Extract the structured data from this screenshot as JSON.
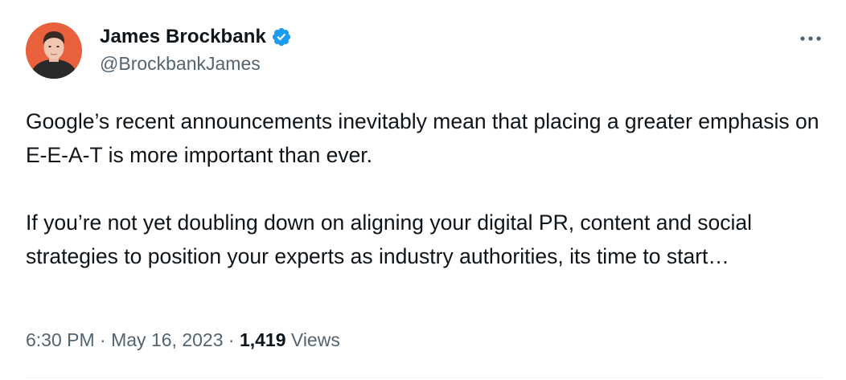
{
  "author": {
    "display_name": "James Brockbank",
    "handle": "@BrockbankJames",
    "verified": true
  },
  "icons": {
    "avatar": "profile-photo",
    "verified": "verified-badge-icon",
    "more": "more-options-icon"
  },
  "colors": {
    "verified_blue": "#1d9bf0",
    "secondary_text": "#536471",
    "avatar_background": "#e8603c"
  },
  "tweet": {
    "paragraphs": [
      "Google’s recent announcements inevitably mean that placing a greater emphasis on E-E-A-T is more important than ever.",
      "If you’re not yet doubling down on aligning your digital PR, content and social strategies to position your experts as industry authorities, its time to start…"
    ]
  },
  "meta": {
    "time": "6:30 PM",
    "separator": "·",
    "date": "May 16, 2023",
    "views_count": "1,419",
    "views_label": "Views"
  }
}
